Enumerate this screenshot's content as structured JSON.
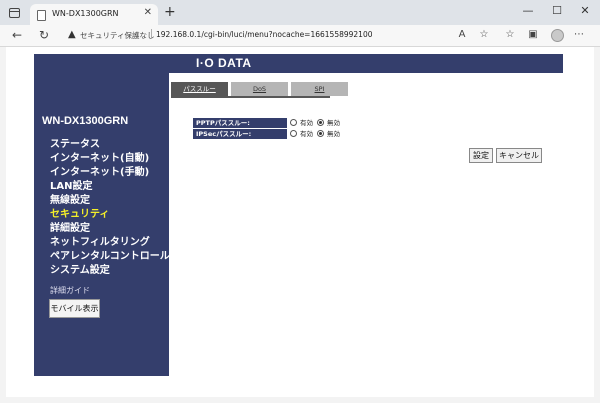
{
  "browser": {
    "tab_title": "WN-DX1300GRN",
    "security_label": "セキュリティ保護なし",
    "url": "192.168.0.1/cgi-bin/luci/menu?nocache=1661558992100",
    "new_tab_glyph": "+",
    "tab_close_glyph": "✕",
    "window_controls": [
      "—",
      "☐",
      "✕"
    ],
    "nav": [
      "←",
      "↻"
    ]
  },
  "brand": {
    "logo": "I·O DATA"
  },
  "sidebar": {
    "model": "WN-DX1300GRN",
    "items": [
      {
        "label": "ステータス",
        "active": false
      },
      {
        "label": "インターネット(自動)",
        "active": false
      },
      {
        "label": "インターネット(手動)",
        "active": false
      },
      {
        "label": "LAN設定",
        "active": false
      },
      {
        "label": "無線設定",
        "active": false
      },
      {
        "label": "セキュリティ",
        "active": true
      },
      {
        "label": "詳細設定",
        "active": false
      },
      {
        "label": "ネットフィルタリング",
        "active": false
      },
      {
        "label": "ペアレンタルコントロール",
        "active": false
      },
      {
        "label": "システム設定",
        "active": false
      }
    ],
    "guide_label": "詳細ガイド",
    "mobile_button": "モバイル表示"
  },
  "subtabs": [
    {
      "label": "パススルー",
      "active": true
    },
    {
      "label": "DoS",
      "active": false
    },
    {
      "label": "SPI",
      "active": false
    }
  ],
  "settings": {
    "rows": [
      {
        "label": "PPTPパススルー:",
        "option_on": "有効",
        "option_off": "無効",
        "selected": "off"
      },
      {
        "label": "IPSecパススルー:",
        "option_on": "有効",
        "option_off": "無効",
        "selected": "off"
      }
    ]
  },
  "buttons": {
    "apply": "設定",
    "cancel": "キャンセル"
  }
}
